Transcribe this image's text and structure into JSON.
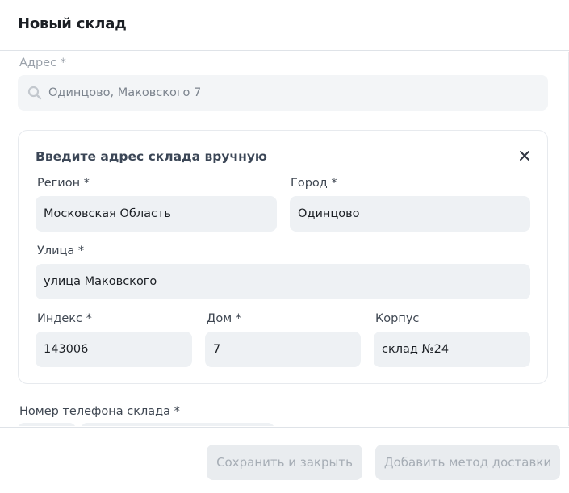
{
  "header": {
    "title": "Новый склад"
  },
  "address": {
    "label": "Адрес *",
    "search_value": "Одинцово, Маковского 7"
  },
  "manual": {
    "title": "Введите адрес склада вручную",
    "region": {
      "label": "Регион *",
      "value": "Московская Область"
    },
    "city": {
      "label": "Город *",
      "value": "Одинцово"
    },
    "street": {
      "label": "Улица *",
      "value": "улица Маковского"
    },
    "index": {
      "label": "Индекс *",
      "value": "143006"
    },
    "house": {
      "label": "Дом *",
      "value": "7"
    },
    "building": {
      "label": "Корпус",
      "value": "склад №24"
    }
  },
  "phone": {
    "label": "Номер телефона склада *"
  },
  "footer": {
    "save_close_label": "Сохранить и закрыть",
    "add_delivery_label": "Добавить метод доставки"
  },
  "icons": {
    "search": "search-icon",
    "close": "close-icon"
  }
}
